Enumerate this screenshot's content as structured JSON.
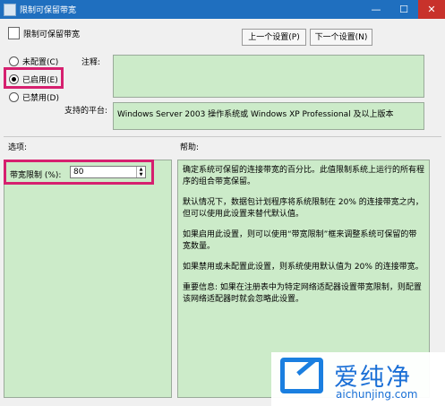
{
  "window": {
    "title": "限制可保留带宽",
    "controls": [
      "—",
      "☐",
      "✕"
    ]
  },
  "header": {
    "title": "限制可保留带宽"
  },
  "nav": {
    "prev_label": "上一个设置(P)",
    "next_label": "下一个设置(N)"
  },
  "radios": [
    {
      "label": "未配置(C)",
      "selected": false
    },
    {
      "label": "已启用(E)",
      "selected": true
    },
    {
      "label": "已禁用(D)",
      "selected": false
    }
  ],
  "comment": {
    "label": "注释:",
    "value": ""
  },
  "platform": {
    "label": "支持的平台:",
    "value": "Windows Server 2003 操作系统或 Windows XP Professional 及以上版本"
  },
  "options": {
    "label": "选项:",
    "field_label": "带宽限制 (%):",
    "field_value": "80"
  },
  "help": {
    "label": "帮助:",
    "paragraphs": [
      "确定系统可保留的连接带宽的百分比。此值限制系统上运行的所有程序的组合带宽保留。",
      "默认情况下，数据包计划程序将系统限制在 20% 的连接带宽之内，但可以使用此设置来替代默认值。",
      "如果启用此设置，则可以使用“带宽限制”框来调整系统可保留的带宽数量。",
      "如果禁用或未配置此设置，则系统使用默认值为 20% 的连接带宽。",
      "重要信息: 如果在注册表中为特定网络适配器设置带宽限制，则配置该网络适配器时就会忽略此设置。"
    ]
  },
  "watermark": {
    "cn": "爱纯净",
    "en": "aichunjing.com"
  },
  "colors": {
    "panel_bg": "#ccebc9",
    "highlight": "#d6206f",
    "titlebar": "#1f6fbf"
  }
}
